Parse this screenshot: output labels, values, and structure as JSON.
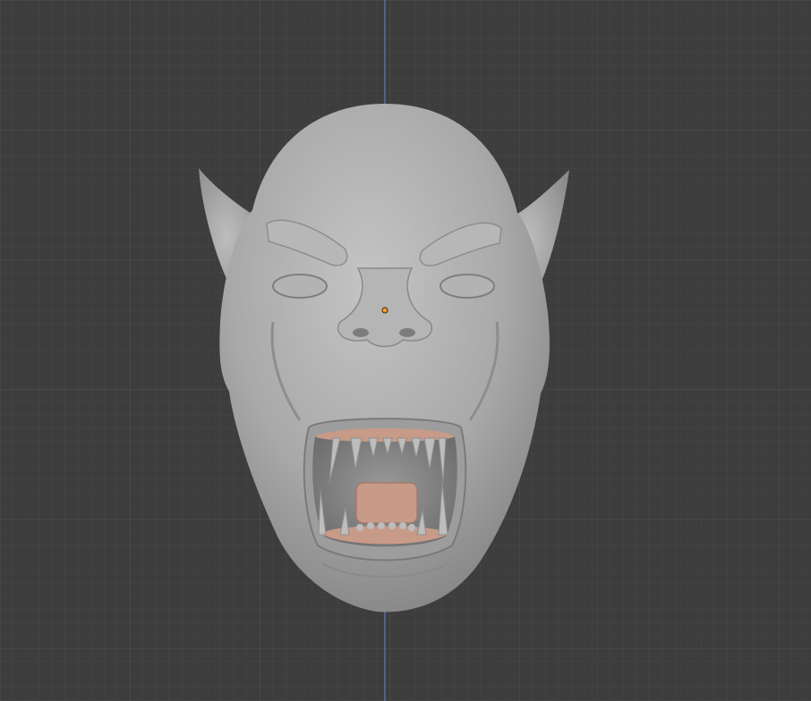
{
  "viewport": {
    "background_color": "#3d3d3d",
    "grid_minor_color": "#474747",
    "grid_major_color": "#525252",
    "axis_z_color": "#5a7fb8",
    "origin_color": "#ff9a2e"
  },
  "model": {
    "object": "orc-head-sculpt",
    "skin_color": "#a6a6a6",
    "mouth_color": "#c89a88",
    "teeth_color": "#b9b9b9"
  }
}
